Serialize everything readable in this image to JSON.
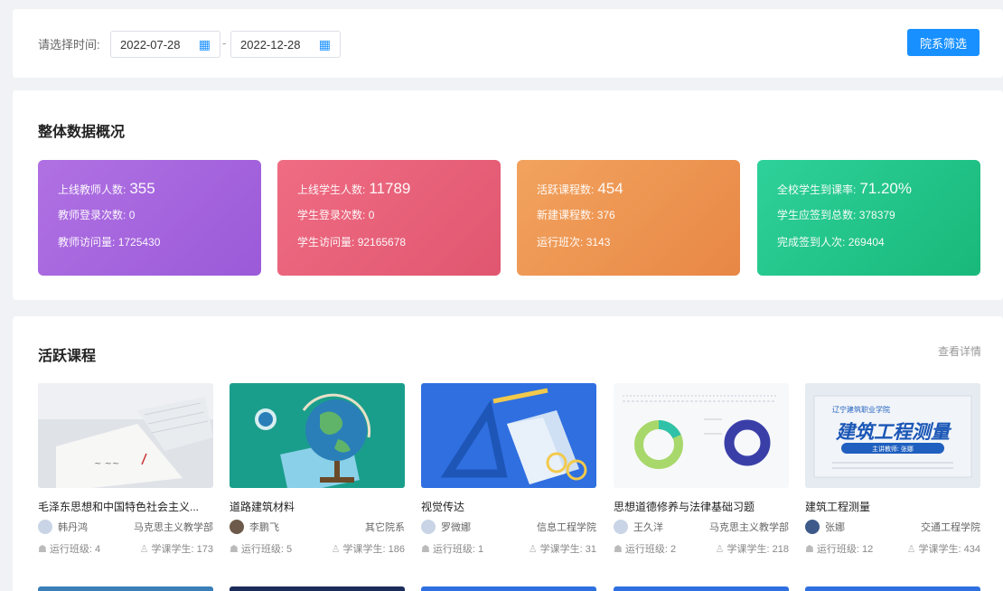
{
  "filter": {
    "label": "请选择时间:",
    "start_date": "2022-07-28",
    "end_date": "2022-12-28",
    "separator": "-",
    "button_label": "院系筛选"
  },
  "overview": {
    "title": "整体数据概况",
    "cards": [
      {
        "rows": [
          {
            "label": "上线教师人数:",
            "value": "355"
          },
          {
            "label": "教师登录次数:",
            "value": "0"
          },
          {
            "label": "教师访问量:",
            "value": "1725430"
          }
        ]
      },
      {
        "rows": [
          {
            "label": "上线学生人数:",
            "value": "11789"
          },
          {
            "label": "学生登录次数:",
            "value": "0"
          },
          {
            "label": "学生访问量:",
            "value": "92165678"
          }
        ]
      },
      {
        "rows": [
          {
            "label": "活跃课程数:",
            "value": "454"
          },
          {
            "label": "新建课程数:",
            "value": "376"
          },
          {
            "label": "运行班次:",
            "value": "3143"
          }
        ]
      },
      {
        "rows": [
          {
            "label": "全校学生到课率:",
            "value": "71.20%"
          },
          {
            "label": "学生应签到总数:",
            "value": "378379"
          },
          {
            "label": "完成签到人次:",
            "value": "269404"
          }
        ]
      }
    ]
  },
  "courses": {
    "title": "活跃课程",
    "more_label": "查看详情",
    "items": [
      {
        "title": "毛泽东思想和中国特色社会主义...",
        "teacher": "韩丹鸿",
        "dept": "马克思主义教学部",
        "classes": "运行班级: 4",
        "students": "学课学生: 173"
      },
      {
        "title": "道路建筑材料",
        "teacher": "李鹏飞",
        "dept": "其它院系",
        "classes": "运行班级: 5",
        "students": "学课学生: 186"
      },
      {
        "title": "视觉传达",
        "teacher": "罗微娜",
        "dept": "信息工程学院",
        "classes": "运行班级: 1",
        "students": "学课学生: 31"
      },
      {
        "title": "思想道德修养与法律基础习题",
        "teacher": "王久洋",
        "dept": "马克思主义教学部",
        "classes": "运行班级: 2",
        "students": "学课学生: 218"
      },
      {
        "title": "建筑工程测量",
        "teacher": "张娜",
        "dept": "交通工程学院",
        "classes": "运行班级: 12",
        "students": "学课学生: 434"
      }
    ],
    "thumb5_school": "辽宁建筑职业学院",
    "thumb5_title": "建筑工程测量",
    "thumb5_sub": "主讲教师: 张娜"
  },
  "colors": {
    "primary": "#1890ff",
    "purple": "#a565de",
    "pink": "#e8627a",
    "orange": "#ed9550",
    "green": "#22c488"
  }
}
